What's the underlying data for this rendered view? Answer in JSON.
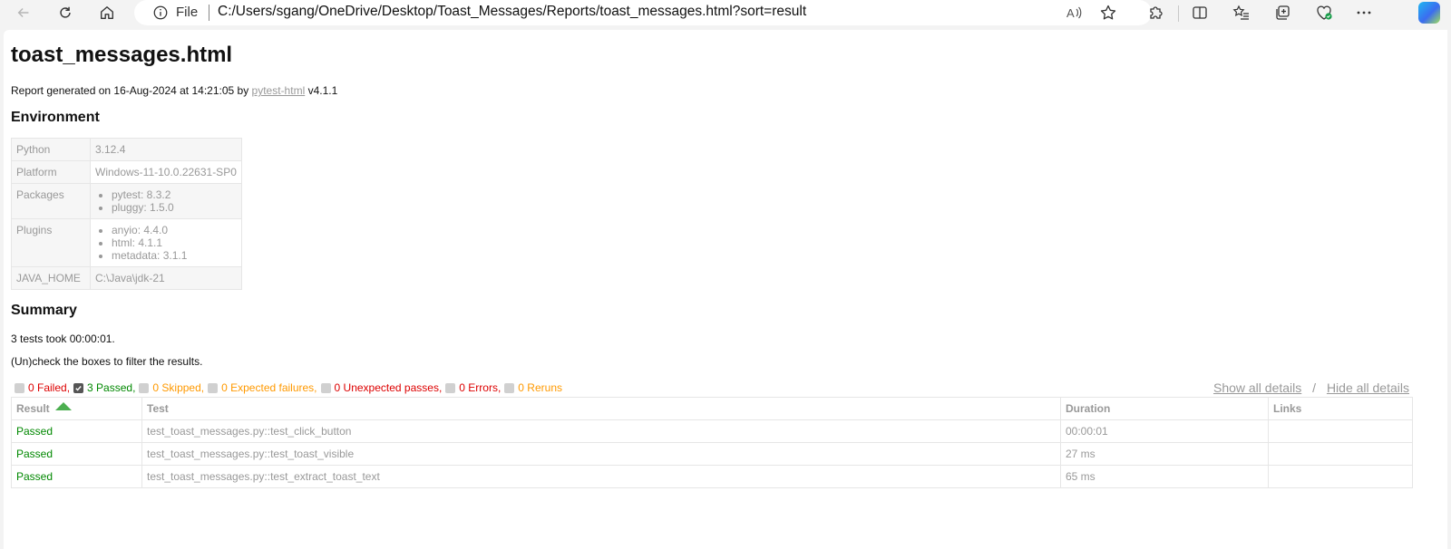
{
  "browser": {
    "addr_file": "File",
    "url": "C:/Users/sgang/OneDrive/Desktop/Toast_Messages/Reports/toast_messages.html?sort=result"
  },
  "report": {
    "title": "toast_messages.html",
    "gen_prefix": "Report generated on 16-Aug-2024 at 14:21:05 by",
    "gen_link": "pytest-html",
    "gen_version": "v4.1.1",
    "environment_heading": "Environment",
    "environment": [
      {
        "key": "Python",
        "value": "3.12.4"
      },
      {
        "key": "Platform",
        "value": "Windows-11-10.0.22631-SP0"
      },
      {
        "key": "Packages",
        "list": [
          "pytest: 8.3.2",
          "pluggy: 1.5.0"
        ]
      },
      {
        "key": "Plugins",
        "list": [
          "anyio: 4.4.0",
          "html: 4.1.1",
          "metadata: 3.1.1"
        ]
      },
      {
        "key": "JAVA_HOME",
        "value": "C:\\Java\\jdk-21"
      }
    ],
    "summary_heading": "Summary",
    "summary_text": "3 tests took 00:00:01.",
    "filter_hint": "(Un)check the boxes to filter the results.",
    "filters": [
      {
        "label": "0 Failed,",
        "checked": false,
        "color": "#dd0000"
      },
      {
        "label": "3 Passed,",
        "checked": true,
        "color": "#008800"
      },
      {
        "label": "0 Skipped,",
        "checked": false,
        "color": "#ff9900"
      },
      {
        "label": "0 Expected failures,",
        "checked": false,
        "color": "#ff9900"
      },
      {
        "label": "0 Unexpected passes,",
        "checked": false,
        "color": "#dd0000"
      },
      {
        "label": "0 Errors,",
        "checked": false,
        "color": "#dd0000"
      },
      {
        "label": "0 Reruns",
        "checked": false,
        "color": "#ff9900"
      }
    ],
    "show_all": "Show all details",
    "slash": "/",
    "hide_all": "Hide all details",
    "columns": [
      "Result",
      "Test",
      "Duration",
      "Links"
    ],
    "rows": [
      {
        "result": "Passed",
        "test": "test_toast_messages.py::test_click_button",
        "duration": "00:00:01",
        "links": ""
      },
      {
        "result": "Passed",
        "test": "test_toast_messages.py::test_toast_visible",
        "duration": "27 ms",
        "links": ""
      },
      {
        "result": "Passed",
        "test": "test_toast_messages.py::test_extract_toast_text",
        "duration": "65 ms",
        "links": ""
      }
    ]
  }
}
